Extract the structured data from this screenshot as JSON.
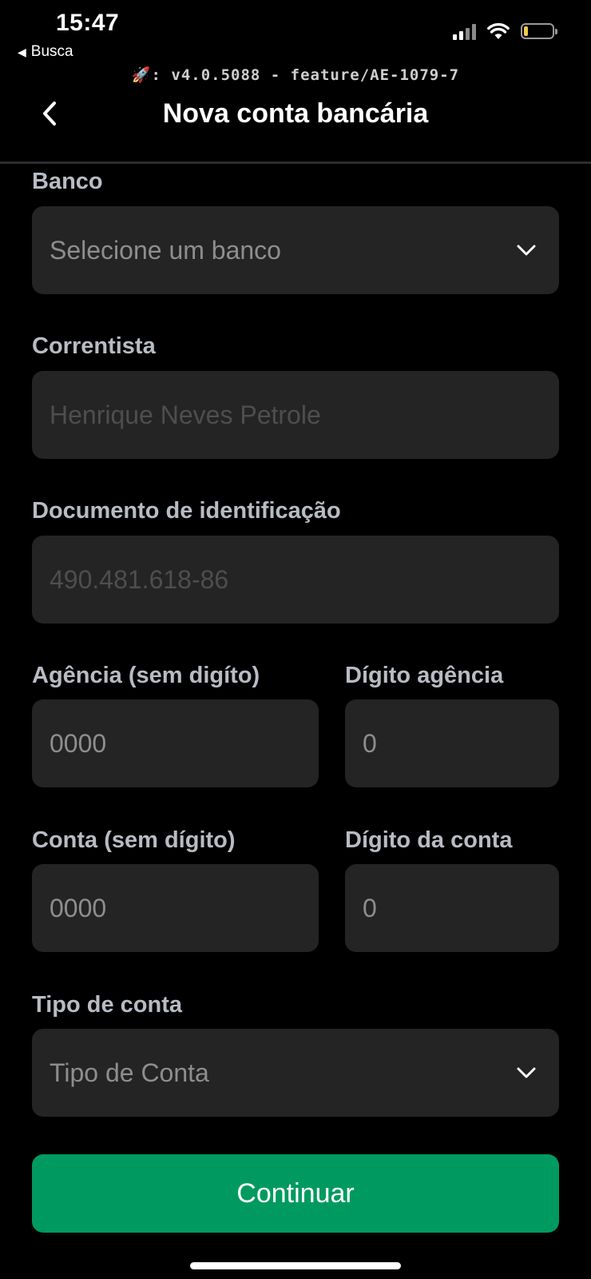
{
  "status_bar": {
    "time": "15:47",
    "back_app": "Busca",
    "battery_level": 0.15,
    "battery_color": "#f2c94c"
  },
  "build_info": "🚀: v4.0.5088 - feature/AE-1079-7",
  "header": {
    "title": "Nova conta bancária",
    "back_icon": "chevron-left-icon"
  },
  "form": {
    "bank": {
      "label": "Banco",
      "placeholder": "Selecione um banco"
    },
    "holder": {
      "label": "Correntista",
      "value": "Henrique Neves Petrole"
    },
    "document": {
      "label": "Documento de identificação",
      "value": "490.481.618-86"
    },
    "agency": {
      "label": "Agência (sem digíto)",
      "placeholder": "0000"
    },
    "agency_digit": {
      "label": "Dígito agência",
      "placeholder": "0"
    },
    "account": {
      "label": "Conta (sem dígito)",
      "placeholder": "0000"
    },
    "account_digit": {
      "label": "Dígito da conta",
      "placeholder": "0"
    },
    "account_type": {
      "label": "Tipo de conta",
      "placeholder": "Tipo de Conta"
    }
  },
  "continue_label": "Continuar",
  "colors": {
    "background": "#000000",
    "field_background": "#242424",
    "label": "#b7bcc4",
    "accent": "#009a60"
  }
}
